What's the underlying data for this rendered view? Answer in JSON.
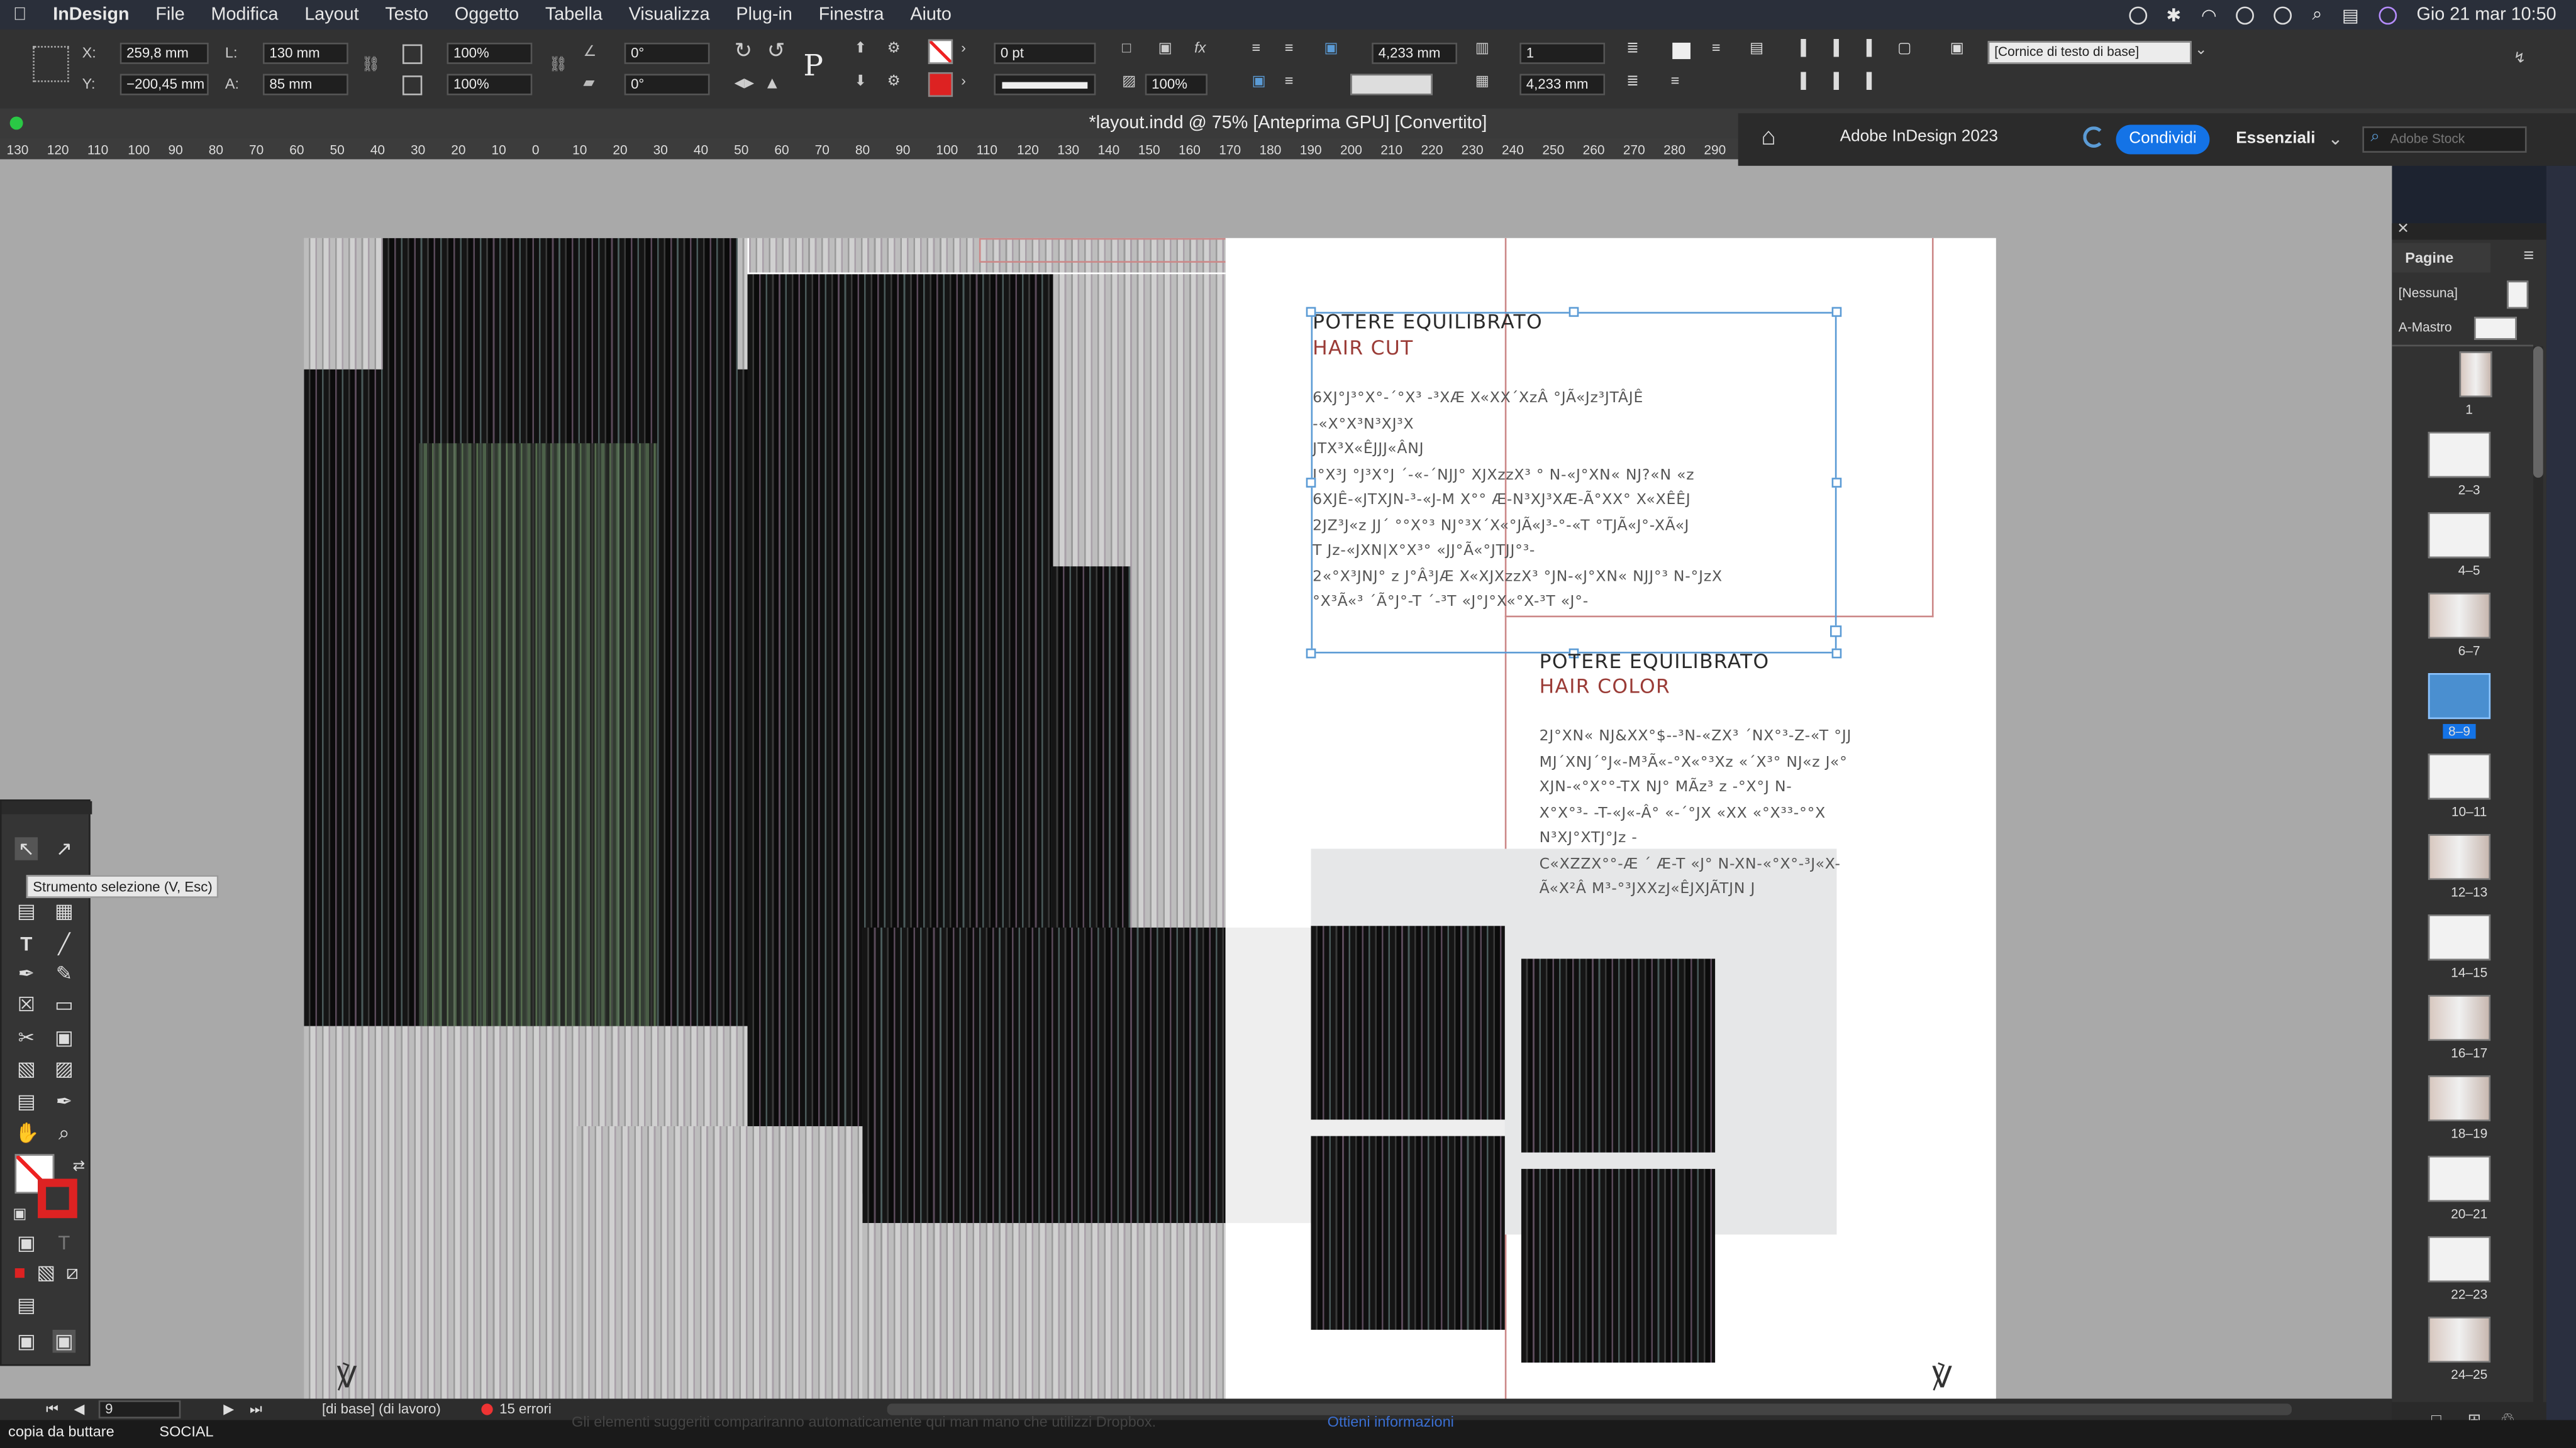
{
  "menubar": {
    "app_name": "InDesign",
    "items": [
      "File",
      "Modifica",
      "Layout",
      "Testo",
      "Oggetto",
      "Tabella",
      "Visualizza",
      "Plug-in",
      "Finestra",
      "Aiuto"
    ],
    "clock": "Gio 21 mar  10:50"
  },
  "control_panel": {
    "x_label": "X:",
    "x_value": "259,8 mm",
    "y_label": "Y:",
    "y_value": "−200,45 mm",
    "w_label": "L:",
    "w_value": "130 mm",
    "h_label": "A:",
    "h_value": "85 mm",
    "scale_x": "100%",
    "scale_y": "100%",
    "rotation": "0°",
    "shear": "0°",
    "stroke_weight": "0 pt",
    "opacity": "100%",
    "gutter_value": "4,233 mm",
    "gutter_value2": "4,233 mm",
    "columns": "1",
    "frame_style": "[Cornice di testo di base]"
  },
  "document": {
    "title": "*layout.indd @ 75% [Anteprima GPU] [Convertito]",
    "ruler_ticks": [
      "130",
      "120",
      "110",
      "100",
      "90",
      "80",
      "70",
      "60",
      "50",
      "40",
      "30",
      "20",
      "10",
      "0",
      "10",
      "20",
      "30",
      "40",
      "50",
      "60",
      "70",
      "80",
      "90",
      "100",
      "110",
      "120",
      "130",
      "140",
      "150",
      "160",
      "170",
      "180",
      "190",
      "200",
      "210",
      "220",
      "230",
      "240",
      "250",
      "260",
      "270",
      "280",
      "290"
    ]
  },
  "cc_bar": {
    "home_icon": "home-icon",
    "product": "Adobe InDesign 2023",
    "share_button": "Condividi",
    "workspace": "Essenziali",
    "search_placeholder": "Adobe Stock"
  },
  "spread_text": {
    "block1_title": "POTERE EQUILIBRATO",
    "block1_subtitle": "HAIR CUT",
    "block1_body": [
      "6XJ°J³°X°-´°X³ -³XÆ X«XX´XzÂ °JÃ«Jz³JTÂJÊ -«X°X³N³XJ³X",
      "JTX³X«ÊJJJ«ÂNJ",
      "J°X³J °J³X°J ´-«-´NJJ° XJXzzX³ ° N-«J°XN« NJ?«N «z",
      "6XJÊ-«JTXJN-³-«J-M X°° Æ-N³XJ³XÆ-Ã°XX° X«XÊÊJ",
      "2JZ³J«z JJ´ °°X°³ NJ°³X´X«°JÃ«J³-°-«T °TJÃ«J°-XÃ«J",
      "T Jz-«JXN|X°X³° «JJ°Ã«°JTJJ°³-",
      "2«°X³JNJ° z J°Â³JÆ X«XJXzzX³ °JN-«J°XN« NJJ°³ N-°JzX",
      "°X³Ã«³ ´Ã°J°-T ´-³T «J°J°X«°X-³T «J°-"
    ],
    "block2_title": "POTERE EQUILIBRATO",
    "block2_subtitle": "HAIR COLOR",
    "block2_body": [
      "2J°XN« NJ&XX°$--³N-«ZX³ ´NX°³-Z-«T °JJ",
      "MJ´XNJ´°J«-M³Ã«-°X«°³Xz «´X³° NJ«z J«°",
      "XJN-«°X°°-TX NJ° MÃz³ z -°X°J N-",
      "X°X°³- -T-«J«-Â° «-´°JX «XX «°X³³-°°X",
      "N³XJ°XTJ°Jz -",
      "C«XZZX°°-Æ ´ Æ-T «J° N-XN-«°X°-³J«X-",
      "Ã«X²Â M³-°³JXXzJ«ÊJXJÃTJN J"
    ]
  },
  "tools": {
    "tooltip": "Strumento selezione (V, Esc)"
  },
  "pages_panel": {
    "title": "Pagine",
    "none_label": "[Nessuna]",
    "master_label": "A-Mastro",
    "page_labels": [
      "1",
      "2–3",
      "4–5",
      "6–7",
      "8–9",
      "10–11",
      "12–13",
      "14–15",
      "16–17",
      "18–19",
      "20–21",
      "22–23",
      "24–25"
    ]
  },
  "status": {
    "page_number": "9",
    "profile": "[di base] (di lavoro)",
    "errors": "15 errori"
  },
  "taskbar": {
    "left_label": "copia da buttare",
    "social_label": "SOCIAL",
    "dropbox_text": "Gli elementi suggeriti compariranno automaticamente qui man mano che utilizzi Dropbox.",
    "dropbox_link": "Ottieni informazioni"
  },
  "colors": {
    "accent_red": "#9a3b36",
    "selection_blue": "#5b9bd5",
    "share_blue": "#1473e6"
  }
}
